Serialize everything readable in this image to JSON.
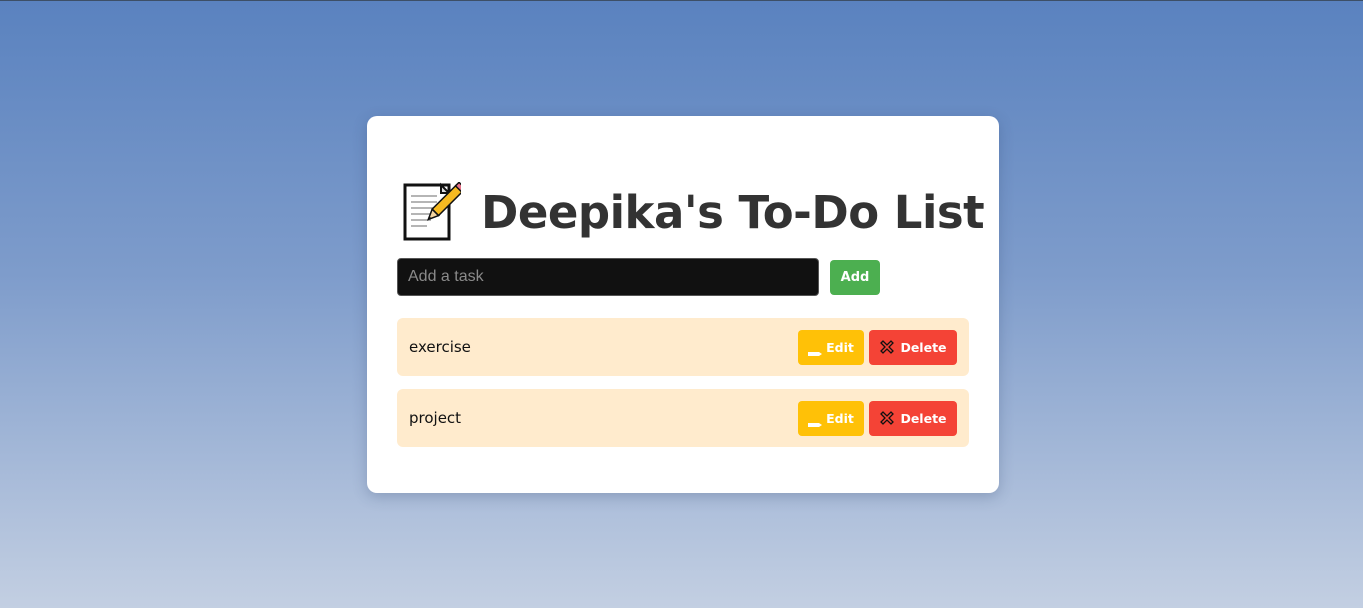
{
  "app": {
    "title": "Deepika's To-Do List",
    "title_icon": "memo-icon"
  },
  "add_task": {
    "placeholder": "Add a task",
    "value": "",
    "button_label": "Add"
  },
  "tasks": [
    {
      "text": "exercise",
      "edit_label": "Edit",
      "delete_label": "Delete"
    },
    {
      "text": "project",
      "edit_label": "Edit",
      "delete_label": "Delete"
    }
  ],
  "colors": {
    "add_button": "#4caf50",
    "edit_button": "#ffc107",
    "delete_button": "#f44336",
    "task_background": "#ffebcd"
  }
}
